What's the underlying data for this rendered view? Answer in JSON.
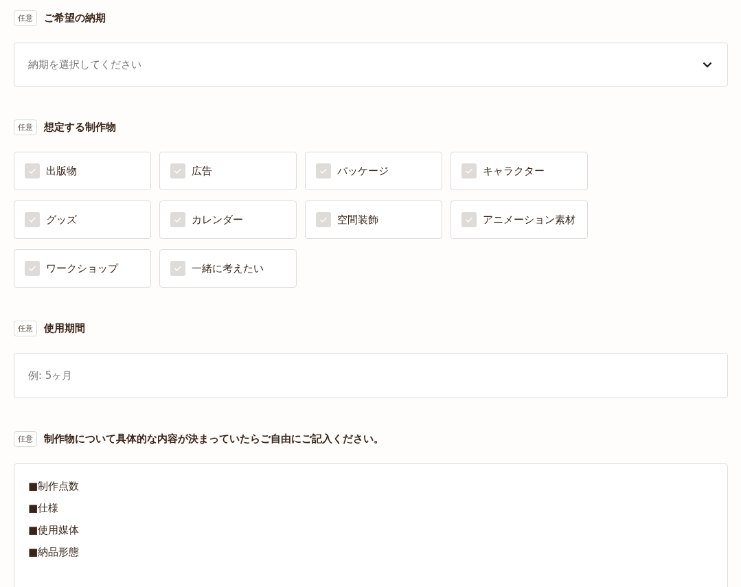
{
  "sections": [
    {
      "kind": "select",
      "badge": "任意",
      "label": "ご希望の納期",
      "placeholder": "納期を選択してください"
    },
    {
      "kind": "checkboxes",
      "badge": "任意",
      "label": "想定する制作物",
      "options": [
        {
          "label": "出版物",
          "checked": false
        },
        {
          "label": "広告",
          "checked": false
        },
        {
          "label": "パッケージ",
          "checked": false
        },
        {
          "label": "キャラクター",
          "checked": false
        },
        {
          "label": "グッズ",
          "checked": false
        },
        {
          "label": "カレンダー",
          "checked": false
        },
        {
          "label": "空間装飾",
          "checked": false
        },
        {
          "label": "アニメーション素材",
          "checked": false
        },
        {
          "label": "ワークショップ",
          "checked": false
        },
        {
          "label": "一緒に考えたい",
          "checked": false
        }
      ]
    },
    {
      "kind": "text",
      "badge": "任意",
      "label": "使用期間",
      "placeholder": "例: 5ヶ月"
    },
    {
      "kind": "textarea",
      "badge": "任意",
      "label": "制作物について具体的な内容が決まっていたらご自由にご記入ください。",
      "value": [
        "■制作点数",
        "■仕様",
        "■使用媒体",
        "■納品形態"
      ]
    }
  ]
}
